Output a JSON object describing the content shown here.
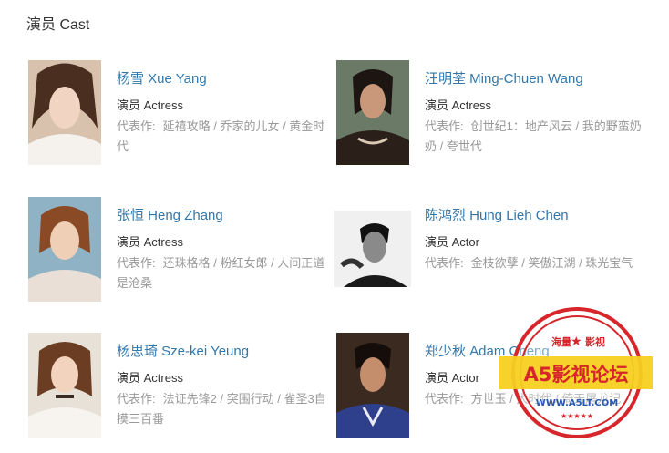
{
  "section": {
    "title": "演员 Cast"
  },
  "cast": [
    {
      "name": "杨雪 Xue Yang",
      "role": "演员 Actress",
      "works_label": "代表作:",
      "works": "延禧攻略 / 乔家的儿女 / 黄金时代"
    },
    {
      "name": "汪明荃 Ming-Chuen Wang",
      "role": "演员 Actress",
      "works_label": "代表作:",
      "works": "创世纪1：地产风云 / 我的野蛮奶奶 / 夸世代"
    },
    {
      "name": "张恒 Heng Zhang",
      "role": "演员 Actress",
      "works_label": "代表作:",
      "works": "还珠格格 / 粉红女郎 / 人间正道是沧桑"
    },
    {
      "name": "陈鸿烈 Hung Lieh Chen",
      "role": "演员 Actor",
      "works_label": "代表作:",
      "works": "金枝欲孽 / 笑傲江湖 / 珠光宝气"
    },
    {
      "name": "杨思琦 Sze-kei Yeung",
      "role": "演员 Actress",
      "works_label": "代表作:",
      "works": "法证先锋2 / 突围行动 / 雀圣3自摸三百番"
    },
    {
      "name": "郑少秋 Adam Cheng",
      "role": "演员 Actor",
      "works_label": "代表作:",
      "works": "方世玉 / 大时代 / 倚天屠龙记"
    }
  ],
  "watermark": {
    "top": "海量",
    "top2": "影视",
    "main": "A5影视论坛",
    "url": "WWW.A5LT.COM"
  },
  "colors": {
    "link": "#3377aa",
    "text": "#333333",
    "muted": "#999999",
    "stamp": "#d7262b",
    "stamp_fill": "#f5d020"
  }
}
